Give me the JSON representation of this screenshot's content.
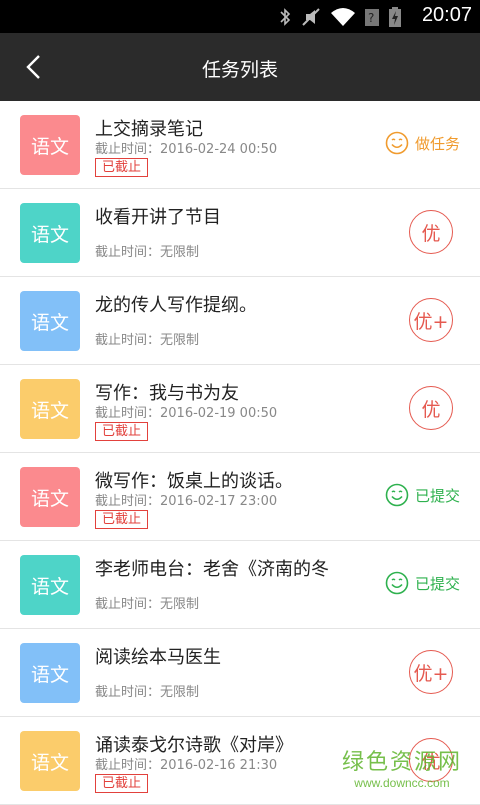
{
  "status_bar": {
    "time": "20:07"
  },
  "header": {
    "title": "任务列表"
  },
  "colors": {
    "pink": "#fb8a8e",
    "teal": "#4ed4c8",
    "blue": "#82c0f8",
    "yellow": "#fbcc6b",
    "orange": "#f09b2e",
    "green": "#2eb14e",
    "red": "#e55a50"
  },
  "tasks": [
    {
      "subject": "语文",
      "color": "#fb8a8e",
      "name": "上交摘录笔记",
      "deadline": "截止时间：2016-02-24 00:50",
      "expired": "已截止",
      "action": "做任务",
      "action_color": "#f09b2e"
    },
    {
      "subject": "语文",
      "color": "#4ed4c8",
      "name": "收看开讲了节目",
      "deadline": "截止时间：无限制",
      "stamp": "优"
    },
    {
      "subject": "语文",
      "color": "#82c0f8",
      "name": "龙的传人写作提纲。",
      "deadline": "截止时间：无限制",
      "stamp": "优+"
    },
    {
      "subject": "语文",
      "color": "#fbcc6b",
      "name": "写作：我与书为友",
      "deadline": "截止时间：2016-02-19 00:50",
      "expired": "已截止",
      "stamp": "优"
    },
    {
      "subject": "语文",
      "color": "#fb8a8e",
      "name": "微写作：饭桌上的谈话。",
      "deadline": "截止时间：2016-02-17 23:00",
      "expired": "已截止",
      "action": "已提交",
      "action_color": "#2eb14e"
    },
    {
      "subject": "语文",
      "color": "#4ed4c8",
      "name": "李老师电台：老舍《济南的冬",
      "deadline": "截止时间：无限制",
      "action": "已提交",
      "action_color": "#2eb14e"
    },
    {
      "subject": "语文",
      "color": "#82c0f8",
      "name": "阅读绘本马医生",
      "deadline": "截止时间：无限制",
      "stamp": "优+"
    },
    {
      "subject": "语文",
      "color": "#fbcc6b",
      "name": "诵读泰戈尔诗歌《对岸》",
      "deadline": "截止时间：2016-02-16 21:30",
      "expired": "已截止",
      "stamp": "优"
    }
  ],
  "watermark": {
    "big": "绿色资源网",
    "small": "www.downcc.com"
  }
}
